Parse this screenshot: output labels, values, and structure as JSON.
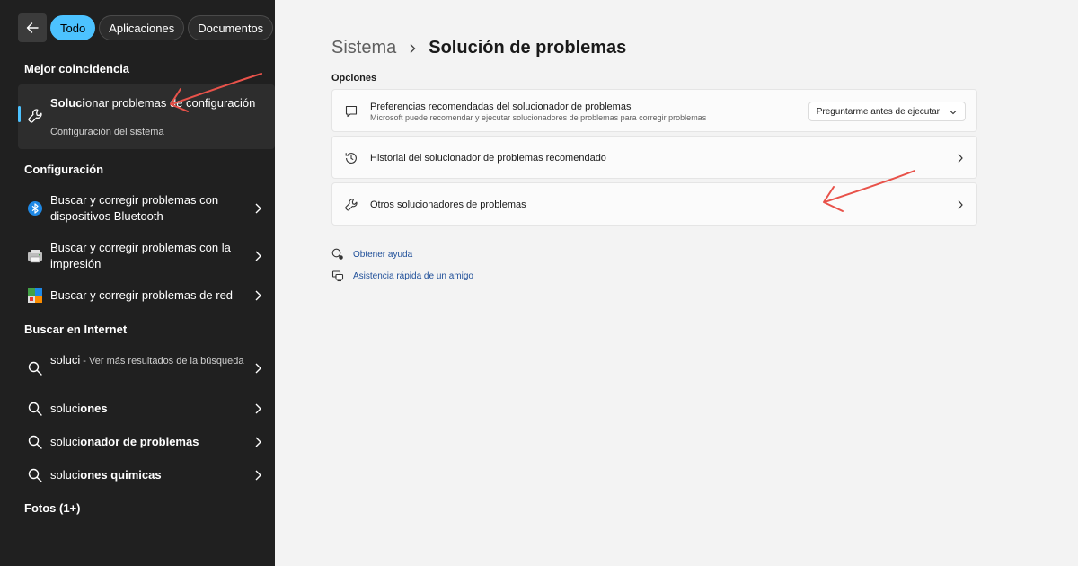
{
  "search_panel": {
    "filters": [
      "Todo",
      "Aplicaciones",
      "Documentos"
    ],
    "best_match": {
      "heading": "Mejor coincidencia",
      "title_bold": "Soluci",
      "title_rest": "onar problemas de configuración",
      "subtitle": "Configuración del sistema",
      "icon": "wrench-icon"
    },
    "config_section": {
      "heading": "Configuración",
      "items": [
        {
          "label": "Buscar y corregir problemas con dispositivos Bluetooth",
          "icon": "bluetooth-icon"
        },
        {
          "label": "Buscar y corregir problemas con la impresión",
          "icon": "printer-icon"
        },
        {
          "label": "Buscar y corregir problemas de red",
          "icon": "network-icon"
        }
      ]
    },
    "web_section": {
      "heading": "Buscar en Internet",
      "items": [
        {
          "bold": "soluci",
          "rest": "",
          "muted": " - Ver más resultados de la búsqueda"
        },
        {
          "bold": "soluci",
          "rest": "ones",
          "muted": ""
        },
        {
          "bold": "soluci",
          "rest": "onador de problemas",
          "muted": ""
        },
        {
          "bold": "soluci",
          "rest": "ones quimicas",
          "muted": ""
        }
      ]
    },
    "photos_heading": "Fotos (1+)"
  },
  "settings": {
    "breadcrumb_parent": "Sistema",
    "breadcrumb_current": "Solución de problemas",
    "section_label": "Opciones",
    "cards": [
      {
        "title": "Preferencias recomendadas del solucionador de problemas",
        "description": "Microsoft puede recomendar y ejecutar solucionadores de problemas para corregir problemas",
        "dropdown_value": "Preguntarme antes de ejecutar",
        "icon": "chat-icon"
      },
      {
        "title": "Historial del solucionador de problemas recomendado",
        "icon": "history-icon"
      },
      {
        "title": "Otros solucionadores de problemas",
        "icon": "wrench-icon"
      }
    ],
    "links": [
      {
        "label": "Obtener ayuda",
        "icon": "help-icon"
      },
      {
        "label": "Asistencia rápida de un amigo",
        "icon": "remote-assist-icon"
      }
    ]
  },
  "colors": {
    "accent": "#4cc2ff",
    "panel_dark": "#202020",
    "annotation_arrow": "#e8524a",
    "link": "#1f4f99"
  }
}
